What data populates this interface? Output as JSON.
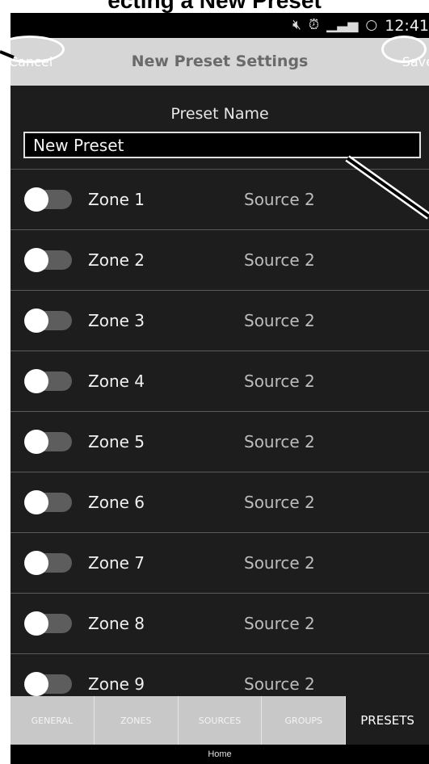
{
  "doc_title": "ecting a New Preset",
  "status_bar": {
    "time": "12:41",
    "icons": [
      "mute-icon",
      "alarm-icon",
      "lte-signal-icon",
      "circle-icon"
    ]
  },
  "header": {
    "cancel_label": "Cancel",
    "title": "New Preset Settings",
    "save_label": "Save"
  },
  "preset": {
    "label": "Preset Name",
    "value": "New Preset"
  },
  "zones": [
    {
      "name": "Zone 1",
      "source": "Source 2",
      "enabled": false
    },
    {
      "name": "Zone 2",
      "source": "Source 2",
      "enabled": false
    },
    {
      "name": "Zone 3",
      "source": "Source 2",
      "enabled": false
    },
    {
      "name": "Zone 4",
      "source": "Source 2",
      "enabled": false
    },
    {
      "name": "Zone 5",
      "source": "Source 2",
      "enabled": false
    },
    {
      "name": "Zone 6",
      "source": "Source 2",
      "enabled": false
    },
    {
      "name": "Zone 7",
      "source": "Source 2",
      "enabled": false
    },
    {
      "name": "Zone 8",
      "source": "Source 2",
      "enabled": false
    },
    {
      "name": "Zone 9",
      "source": "Source 2",
      "enabled": false
    }
  ],
  "tabs": [
    {
      "label": "GENERAL",
      "active": false
    },
    {
      "label": "ZONES",
      "active": false
    },
    {
      "label": "SOURCES",
      "active": false
    },
    {
      "label": "GROUPS",
      "active": false
    },
    {
      "label": "PRESETS",
      "active": true
    }
  ],
  "bottom": {
    "home_label": "Home"
  }
}
